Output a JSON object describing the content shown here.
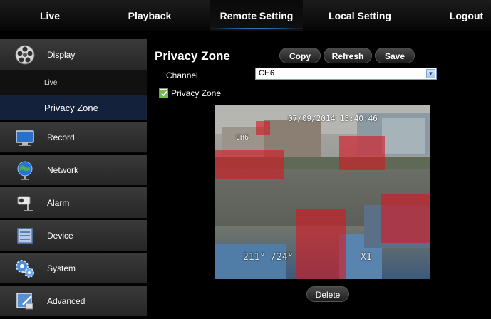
{
  "topbar": {
    "tabs": [
      {
        "label": "Live"
      },
      {
        "label": "Playback"
      },
      {
        "label": "Remote Setting"
      },
      {
        "label": "Local Setting"
      },
      {
        "label": "Logout"
      }
    ],
    "active_tab": "Remote Setting"
  },
  "sidebar": {
    "items": [
      {
        "label": "Display",
        "icon": "film-reel-icon"
      },
      {
        "label": "Record",
        "icon": "monitor-icon"
      },
      {
        "label": "Network",
        "icon": "globe-icon"
      },
      {
        "label": "Alarm",
        "icon": "camera-alarm-icon"
      },
      {
        "label": "Device",
        "icon": "hard-drive-icon"
      },
      {
        "label": "System",
        "icon": "gears-icon"
      },
      {
        "label": "Advanced",
        "icon": "advanced-tools-icon"
      }
    ],
    "display_submenu": [
      {
        "label": "Live"
      },
      {
        "label": "Privacy Zone",
        "active": true
      }
    ]
  },
  "main": {
    "title": "Privacy Zone",
    "buttons": {
      "copy": "Copy",
      "refresh": "Refresh",
      "save": "Save",
      "delete": "Delete"
    },
    "channel": {
      "label": "Channel",
      "value": "CH6"
    },
    "privacy_zone_checkbox": {
      "label": "Privacy Zone",
      "checked": true
    },
    "video": {
      "timestamp": "07/09/2014 15:40:46",
      "channel_osd": "CH6",
      "ptz_readout": "211° /24°",
      "zoom_readout": "X1",
      "zone_color": "#d71923",
      "zone_count": 5
    }
  },
  "colors": {
    "accent_blue": "#2a6fd0",
    "active_submenu_bg": "#14213a"
  }
}
